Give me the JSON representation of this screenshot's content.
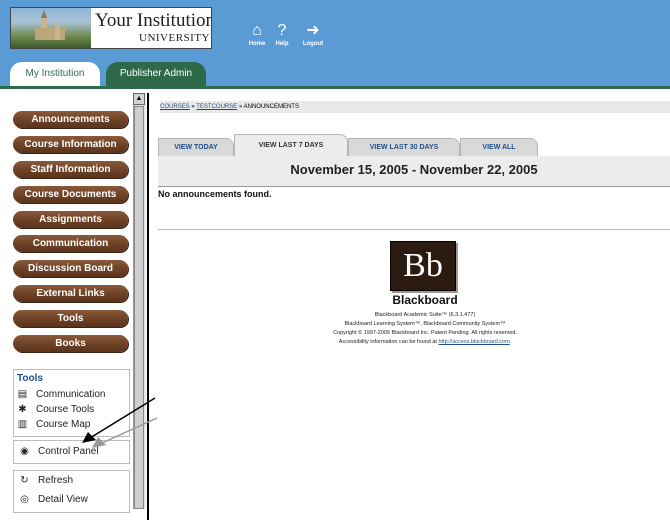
{
  "header": {
    "logo": {
      "institution": "Your Institution",
      "university": "UNIVERSITY"
    },
    "buttons": [
      {
        "label": "Home",
        "icon": "home-icon"
      },
      {
        "label": "Help",
        "icon": "help-icon"
      },
      {
        "label": "Logout",
        "icon": "logout-icon"
      }
    ],
    "tabs": [
      {
        "label": "My Institution",
        "active": true
      },
      {
        "label": "Publisher Admin",
        "active": false
      }
    ]
  },
  "sidebar": {
    "nav_buttons": [
      "Announcements",
      "Course Information",
      "Staff Information",
      "Course Documents",
      "Assignments",
      "Communication",
      "Discussion Board",
      "External Links",
      "Tools",
      "Books"
    ],
    "tools_panel": {
      "title": "Tools",
      "items": [
        {
          "label": "Communication",
          "icon": "communication-icon"
        },
        {
          "label": "Course Tools",
          "icon": "course-tools-icon"
        },
        {
          "label": "Course Map",
          "icon": "course-map-icon"
        }
      ]
    },
    "control_panel": {
      "label": "Control Panel",
      "icon": "control-panel-icon"
    },
    "view_panel": {
      "items": [
        {
          "label": "Refresh",
          "icon": "refresh-icon"
        },
        {
          "label": "Detail View",
          "icon": "detail-view-icon"
        }
      ]
    }
  },
  "main": {
    "breadcrumb": {
      "course": "COURSES",
      "sep1": "»",
      "testcourse": "TESTCOURSE",
      "sep2": "»",
      "current": "ANNOUNCEMENTS"
    },
    "tabs": [
      {
        "label": "VIEW TODAY",
        "active": false
      },
      {
        "label": "VIEW LAST 7 DAYS",
        "active": true
      },
      {
        "label": "VIEW LAST 30 DAYS",
        "active": false
      },
      {
        "label": "VIEW ALL",
        "active": false
      }
    ],
    "date_range": "November 15, 2005 - November 22, 2005",
    "empty_message": "No announcements found.",
    "footer": {
      "logo_text": "Bb",
      "brand": "Blackboard",
      "lines": [
        "Blackboard Academic Suite™ (6.3.1.477)",
        "Blackboard Learning System™, Blackboard Community System™",
        "Copyright © 1997-2005 Blackboard Inc. Patent Pending. All rights reserved."
      ],
      "access_prefix": "Accessibility information can be found at",
      "access_link": "http://access.blackboard.com",
      "access_suffix": "."
    }
  },
  "colors": {
    "header_bg": "#5b9bd5",
    "tab_green": "#2e6a4a",
    "nav_brown": "#6f4328",
    "link_blue": "#1f4e8c"
  }
}
